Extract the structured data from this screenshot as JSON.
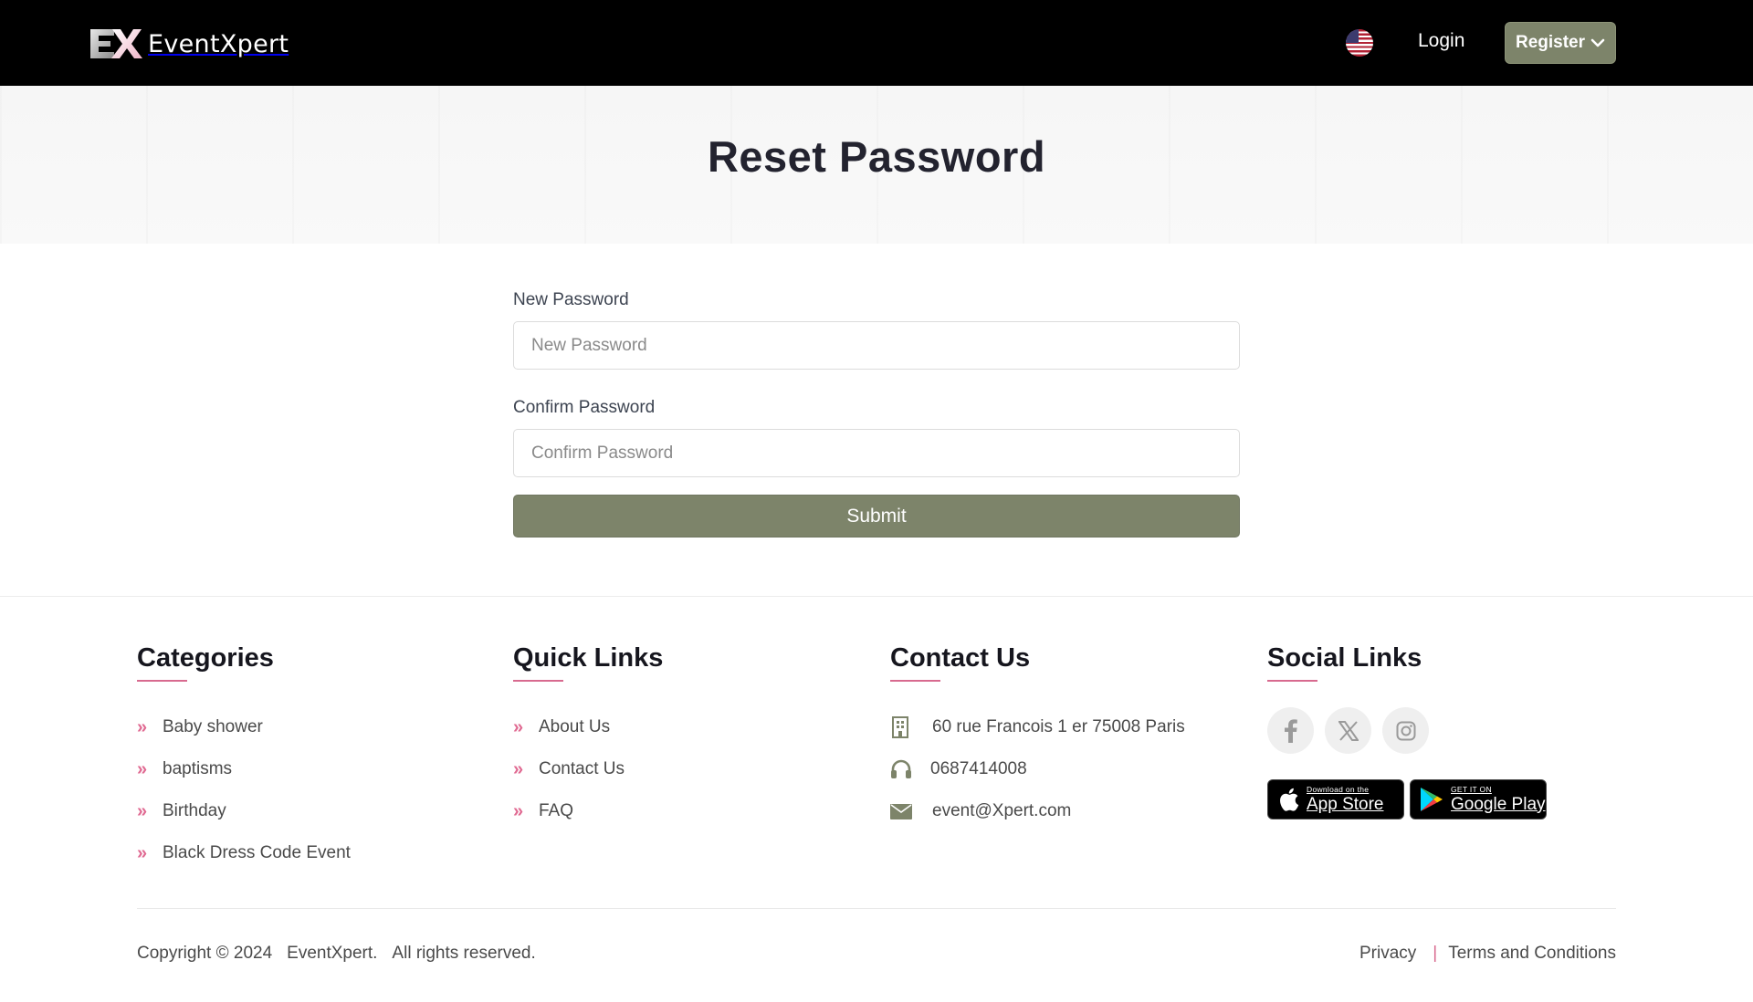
{
  "header": {
    "logo_mark": "EX",
    "logo_text": "EventXpert",
    "login_label": "Login",
    "register_label": "Register",
    "language_icon": "us-flag-icon"
  },
  "banner": {
    "title": "Reset Password"
  },
  "form": {
    "new_password_label": "New Password",
    "new_password_placeholder": "New Password",
    "new_password_value": "",
    "confirm_password_label": "Confirm Password",
    "confirm_password_placeholder": "Confirm Password",
    "confirm_password_value": "",
    "submit_label": "Submit"
  },
  "footer": {
    "categories": {
      "title": "Categories",
      "items": [
        "Baby shower",
        "baptisms",
        "Birthday",
        "Black Dress Code Event"
      ]
    },
    "quick_links": {
      "title": "Quick Links",
      "items": [
        "About Us",
        "Contact Us",
        "FAQ"
      ]
    },
    "contact": {
      "title": "Contact Us",
      "address": "60 rue Francois 1 er 75008 Paris",
      "phone": "0687414008",
      "email": "event@Xpert.com"
    },
    "social": {
      "title": "Social Links",
      "icons": [
        "facebook-icon",
        "x-icon",
        "instagram-icon"
      ],
      "app_store_small": "Download on the",
      "app_store_big": "App Store",
      "google_play_small": "GET IT ON",
      "google_play_big": "Google Play"
    },
    "copyright": {
      "text": "Copyright © 2024",
      "brand": "EventXpert.",
      "rights": "All rights reserved."
    },
    "legal": {
      "privacy": "Privacy",
      "separator": "|",
      "terms": "Terms and Conditions"
    }
  },
  "colors": {
    "accent": "#7d846a",
    "underline": "#d86a8f",
    "header_bg": "#000000"
  }
}
